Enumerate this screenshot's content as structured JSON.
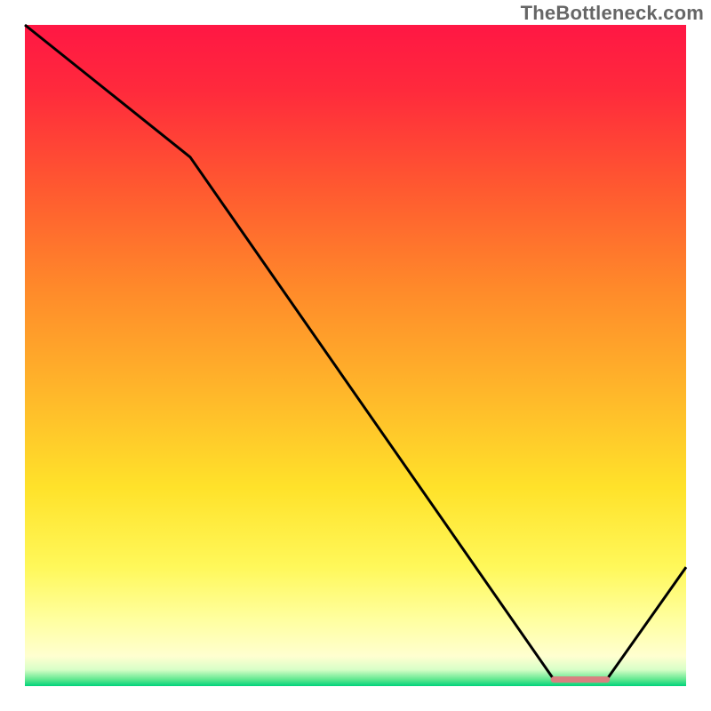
{
  "watermark": "TheBottleneck.com",
  "chart_data": {
    "type": "line",
    "title": "",
    "xlabel": "",
    "ylabel": "",
    "xlim": [
      0,
      100
    ],
    "ylim": [
      0,
      100
    ],
    "x": [
      0,
      25,
      80,
      88,
      100
    ],
    "values": [
      100,
      80,
      1,
      1,
      18
    ],
    "gradient_stops": [
      {
        "offset": 0.0,
        "color": "#ff1744"
      },
      {
        "offset": 0.1,
        "color": "#ff2a3c"
      },
      {
        "offset": 0.25,
        "color": "#ff5a30"
      },
      {
        "offset": 0.4,
        "color": "#ff8a2a"
      },
      {
        "offset": 0.55,
        "color": "#ffb52a"
      },
      {
        "offset": 0.7,
        "color": "#ffe22a"
      },
      {
        "offset": 0.82,
        "color": "#fff85a"
      },
      {
        "offset": 0.9,
        "color": "#ffffa0"
      },
      {
        "offset": 0.955,
        "color": "#ffffd0"
      },
      {
        "offset": 0.975,
        "color": "#d8ffc8"
      },
      {
        "offset": 0.99,
        "color": "#60e890"
      },
      {
        "offset": 1.0,
        "color": "#00d27a"
      }
    ],
    "flat_marker": {
      "x_start": 80,
      "x_end": 88,
      "y": 1,
      "color": "#d98080"
    },
    "plot_bg_outline": "#000000"
  }
}
